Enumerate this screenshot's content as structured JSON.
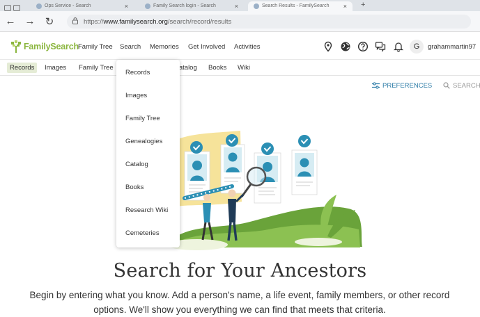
{
  "browser": {
    "tabs": [
      {
        "label": "Ops Service - Search"
      },
      {
        "label": "Family Search login - Search"
      },
      {
        "label": "Search Results - FamilySearch"
      }
    ],
    "url_prefix": "https://",
    "url_domain": "www.familysearch.org",
    "url_path": "/search/record/results"
  },
  "header": {
    "logo_text": "FamilySearch",
    "nav": [
      "Family Tree",
      "Search",
      "Memories",
      "Get Involved",
      "Activities"
    ],
    "icons": [
      "location-pin-icon",
      "globe-icon",
      "help-icon",
      "chat-icon",
      "bell-icon"
    ],
    "avatar_letter": "G",
    "username": "grahammartin97"
  },
  "subnav": {
    "items": [
      "Records",
      "Images",
      "Family Tree",
      "Catalog",
      "Books",
      "Wiki"
    ],
    "active": "Records"
  },
  "toolbar": {
    "preferences_label": "PREFERENCES",
    "search_label": "SEARCH"
  },
  "dropdown": {
    "items": [
      "Records",
      "Images",
      "Family Tree",
      "Genealogies",
      "Catalog",
      "Books",
      "Research Wiki",
      "Cemeteries"
    ]
  },
  "hero": {
    "title": "Search for Your Ancestors",
    "subtitle": "Begin by entering what you know. Add a person's name, a life event, family members, or other record options. We'll show you everything we can find that meets that criteria."
  },
  "colors": {
    "brand_green": "#8bb63f",
    "link_blue": "#2a7aa6",
    "active_tab_bg": "#e5ecd6",
    "illustration_teal": "#2b8fb4"
  }
}
